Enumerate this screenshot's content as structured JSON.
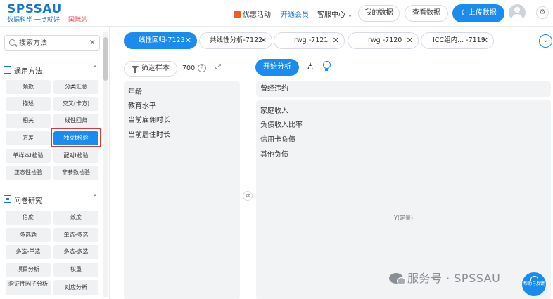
{
  "header": {
    "logo_title": "SPSSAU",
    "logo_sub": "数据科学 一点就好",
    "logo_intl": "国际站",
    "nav": {
      "promo": "优惠活动",
      "vip": "开通会员",
      "service": "客服中心",
      "my_data": "我的数据",
      "view_data": "查看数据",
      "upload": "上传数据"
    }
  },
  "sidebar": {
    "search_placeholder": "搜索方法",
    "sections": [
      {
        "label": "通用方法",
        "items": [
          "频数",
          "分类汇总",
          "描述",
          "交叉(卡方)",
          "相关",
          "线性回归",
          "方差",
          "独立t检验",
          "单样本t检验",
          "配对t检验",
          "正态性检验",
          "非参数检验"
        ]
      },
      {
        "label": "问卷研究",
        "items": [
          "信度",
          "效度",
          "多选题",
          "单选-多选",
          "多选-单选",
          "多选-多选",
          "项目分析",
          "权重",
          "验证性因子分析",
          "对应分析"
        ]
      }
    ],
    "active_item": "独立t检验"
  },
  "tabs": [
    {
      "label": "线性回归-7123",
      "active": true
    },
    {
      "label": "共线性分析-7122",
      "active": false
    },
    {
      "label": "rwg -7121",
      "active": false
    },
    {
      "label": "rwg -7120",
      "active": false
    },
    {
      "label": "ICC组内...  -7119",
      "active": false
    }
  ],
  "variables_panel": {
    "filter_label": "筛选样本",
    "sample_count": "700",
    "variables": [
      "年龄",
      "教育水平",
      "当前雇佣时长",
      "当前居住时长"
    ]
  },
  "analysis_panel": {
    "start_label": "开始分析",
    "x_variable": "曾经违约",
    "y_variables": [
      "家庭收入",
      "负债收入比率",
      "信用卡负债",
      "其他负债"
    ],
    "y_caption": "Y(定量)"
  },
  "watermark": "服务号 · SPSSAU",
  "help_float_label": "帮助与反馈",
  "icons": [
    "search-icon",
    "clear-icon",
    "folder-icon",
    "survey-icon",
    "chevron-up-icon",
    "filter-icon",
    "help-icon",
    "fullscreen-icon",
    "swap-icon",
    "chart-icon",
    "bulb-icon",
    "upload-icon",
    "avatar-icon",
    "gear-icon",
    "chevron-down-icon",
    "close-icon",
    "wechat-icon"
  ]
}
